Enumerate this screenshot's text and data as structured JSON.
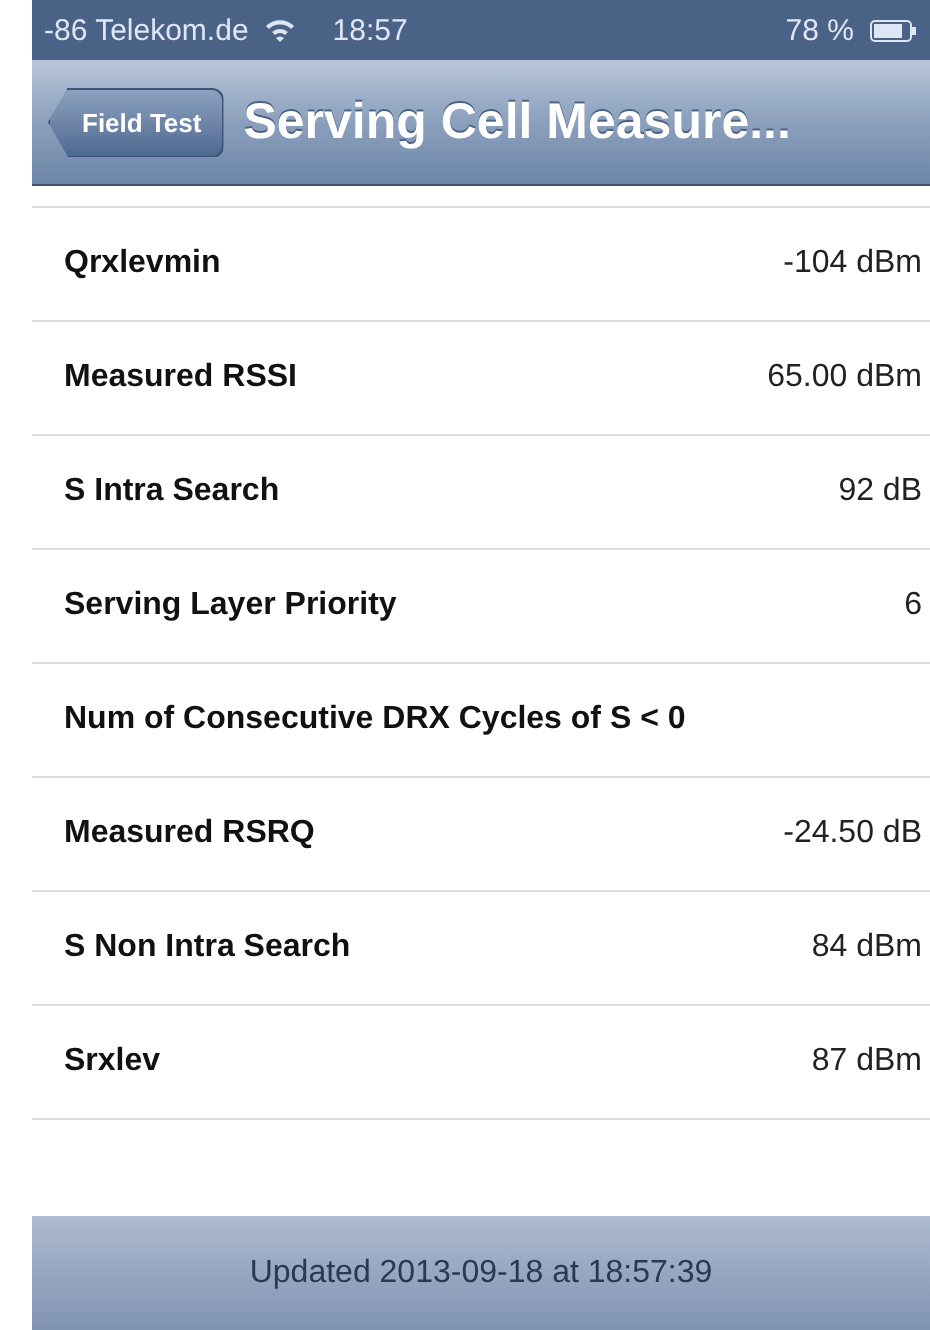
{
  "status_bar": {
    "carrier": "-86 Telekom.de",
    "time": "18:57",
    "battery": "78 %"
  },
  "nav_bar": {
    "back_button": "Field Test",
    "title": "Serving Cell Measure..."
  },
  "rows": [
    {
      "label": "Qrxlevmin",
      "value": "-104 dBm"
    },
    {
      "label": "Measured RSSI",
      "value": "65.00 dBm"
    },
    {
      "label": "S Intra Search",
      "value": "92 dB"
    },
    {
      "label": "Serving Layer Priority",
      "value": "6"
    },
    {
      "label": "Num of Consecutive DRX Cycles of S < 0"
    },
    {
      "label": "Measured RSRQ",
      "value": "-24.50 dB"
    },
    {
      "label": "S Non Intra Search",
      "value": "84 dBm"
    },
    {
      "label": "Srxlev",
      "value": "87 dBm"
    }
  ],
  "footer": "Updated 2013-09-18 at 18:57:39"
}
